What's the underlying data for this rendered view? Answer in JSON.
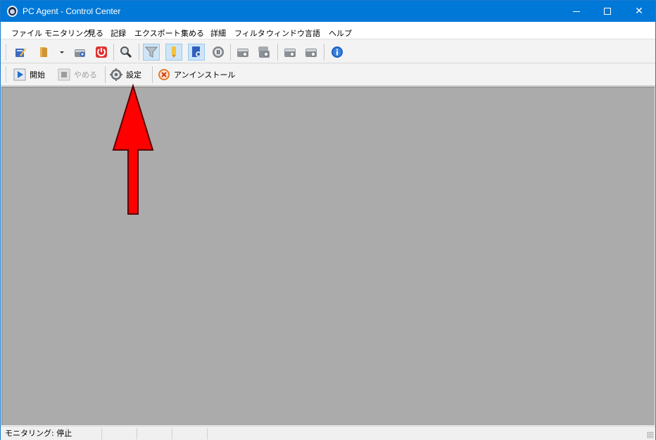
{
  "window": {
    "title": "PC Agent - Control Center"
  },
  "menubar": {
    "items": [
      {
        "label": "ファイル"
      },
      {
        "label": "モニタリング"
      },
      {
        "label": "見る"
      },
      {
        "label": "記録"
      },
      {
        "label": "エクスポート"
      },
      {
        "label": "集める"
      },
      {
        "label": "詳細"
      },
      {
        "label": "フィルタ"
      },
      {
        "label": "ウィンドウ"
      },
      {
        "label": "言語"
      },
      {
        "label": "ヘルプ"
      }
    ]
  },
  "toolbar2": {
    "start_label": "開始",
    "stop_label": "やめる",
    "settings_label": "設定",
    "uninstall_label": "アンインストール"
  },
  "statusbar": {
    "monitoring_status": "モニタリング: 停止"
  },
  "colors": {
    "titlebar": "#0078d7",
    "client_bg": "#ababab",
    "annotation_arrow": "#ff0000"
  },
  "icons": [
    "app-icon",
    "edit-icon",
    "folder-icon",
    "dropdown-icon",
    "camera-icon",
    "power-icon",
    "search-icon",
    "filter-icon",
    "highlight-icon",
    "document-icon",
    "clock-icon",
    "disk-icon",
    "disk-stack-icon",
    "disk-plus-icon",
    "disk-minus-icon",
    "info-icon",
    "play-icon",
    "stop-icon",
    "gear-icon",
    "uninstall-icon"
  ]
}
